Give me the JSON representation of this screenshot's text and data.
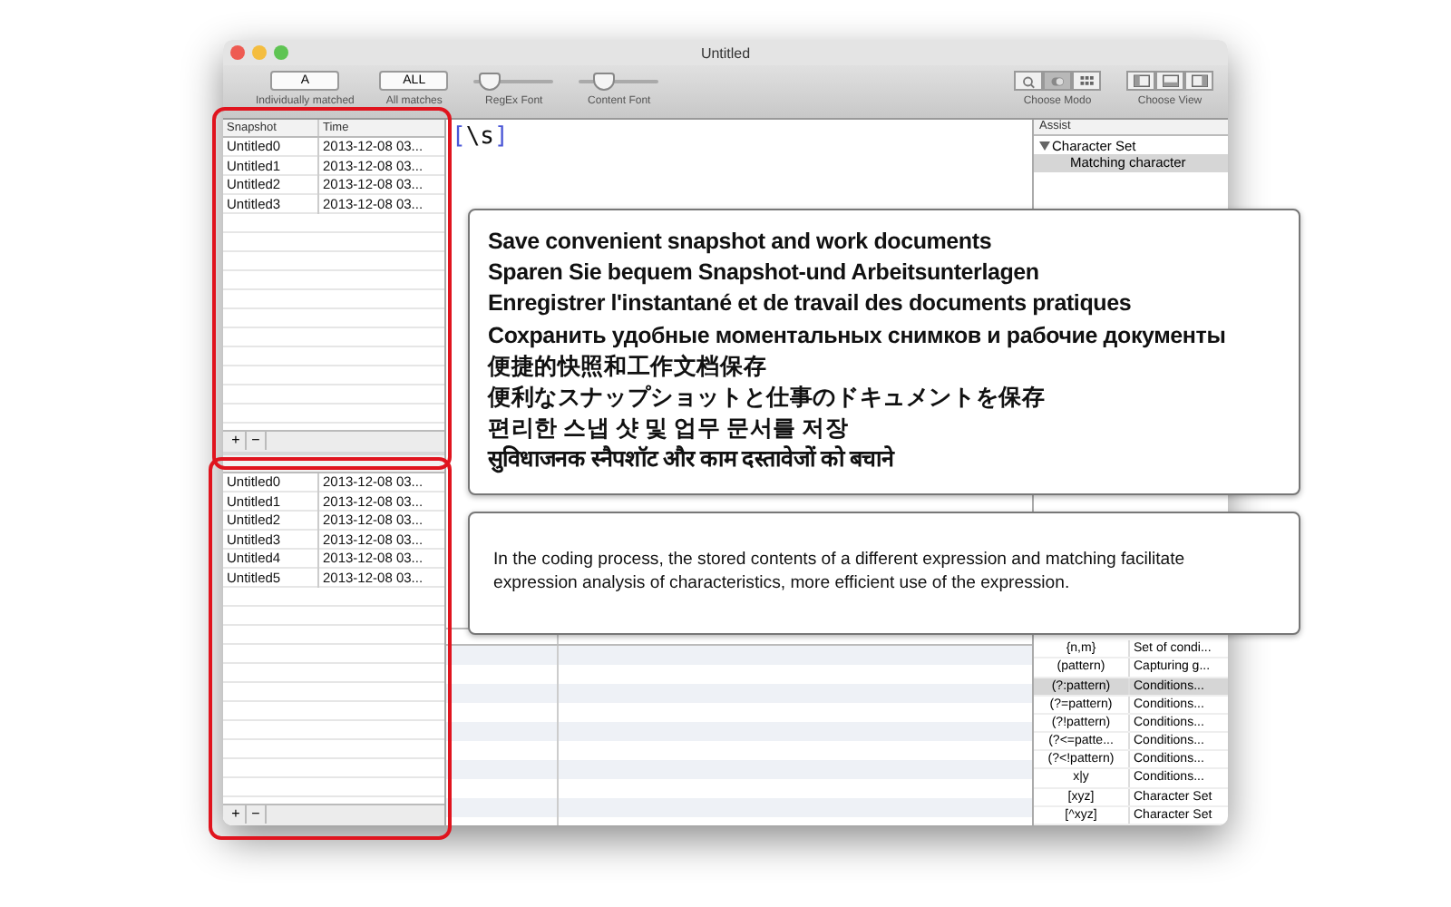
{
  "window": {
    "title": "Untitled"
  },
  "toolbar": {
    "buttons": [
      {
        "label": "A",
        "caption": "Individually matched"
      },
      {
        "label": "ALL",
        "caption": "All matches"
      }
    ],
    "sliders": [
      {
        "caption": "RegEx Font",
        "level": 0.2
      },
      {
        "caption": "Content Font",
        "level": 0.3
      }
    ],
    "segment_groups": [
      {
        "caption": "Choose Modo",
        "segments": [
          {
            "kind": "search",
            "selected": false
          },
          {
            "kind": "toggle",
            "selected": true
          },
          {
            "kind": "grid",
            "selected": false
          }
        ]
      },
      {
        "caption": "Choose View",
        "segments": [
          {
            "kind": "left",
            "selected": false
          },
          {
            "kind": "bottom",
            "selected": false
          },
          {
            "kind": "right",
            "selected": false
          }
        ]
      }
    ]
  },
  "snapshot_table": {
    "columns": [
      "Snapshot",
      "Time"
    ],
    "rows": [
      [
        "Untitled0",
        "2013-12-08 03..."
      ],
      [
        "Untitled1",
        "2013-12-08 03..."
      ],
      [
        "Untitled2",
        "2013-12-08 03..."
      ],
      [
        "Untitled3",
        "2013-12-08 03..."
      ]
    ],
    "buttons": [
      "+",
      "−"
    ]
  },
  "content_table": {
    "rows": [
      [
        "Untitled0",
        "2013-12-08 03..."
      ],
      [
        "Untitled1",
        "2013-12-08 03..."
      ],
      [
        "Untitled2",
        "2013-12-08 03..."
      ],
      [
        "Untitled3",
        "2013-12-08 03..."
      ],
      [
        "Untitled4",
        "2013-12-08 03..."
      ],
      [
        "Untitled5",
        "2013-12-08 03..."
      ]
    ],
    "buttons": [
      "+",
      "−"
    ]
  },
  "editor": {
    "tokens": [
      {
        "text": "[",
        "kind": "bracket"
      },
      {
        "text": "\\s",
        "kind": "escape"
      },
      {
        "text": "]",
        "kind": "bracket"
      }
    ]
  },
  "assist": {
    "header": "Assist",
    "tree": [
      {
        "label": "Character Set",
        "expanded": true,
        "children": [
          {
            "label": "Matching character",
            "selected": true
          }
        ]
      }
    ],
    "rows": [
      {
        "pattern": "{n,m}",
        "description": "Set of condi...",
        "selected": false
      },
      {
        "pattern": "(pattern)",
        "description": "Capturing g...",
        "selected": false
      },
      {
        "pattern": "(?:pattern)",
        "description": "Conditions...",
        "selected": true
      },
      {
        "pattern": "(?=pattern)",
        "description": "Conditions...",
        "selected": false
      },
      {
        "pattern": "(?!pattern)",
        "description": "Conditions...",
        "selected": false
      },
      {
        "pattern": "(?<=patte...",
        "description": "Conditions...",
        "selected": false
      },
      {
        "pattern": "(?<!pattern)",
        "description": "Conditions...",
        "selected": false
      },
      {
        "pattern": "x|y",
        "description": "Conditions...",
        "selected": false
      },
      {
        "pattern": "[xyz]",
        "description": "Character Set",
        "selected": false
      },
      {
        "pattern": "[^xyz]",
        "description": "Character Set",
        "selected": false
      }
    ]
  },
  "callouts": [
    {
      "kind": "lines",
      "lines": [
        "Save convenient snapshot and work documents",
        "Sparen Sie bequem Snapshot-und Arbeitsunterlagen",
        "Enregistrer l'instantané et de travail des documents pratiques",
        "Сохранить удобные моментальных снимков и рабочие документы",
        "便捷的快照和工作文档保存",
        "便利なスナップショットと仕事のドキュメントを保存",
        "편리한 스냅 샷 및 업무 문서를 저장",
        "सुविधाजनक स्नैपशॉट और काम दस्तावेजों को बचाने"
      ]
    },
    {
      "kind": "paragraph",
      "text": "In the coding process, the stored contents of a different expression and matching facilitate expression analysis of characteristics, more efficient use of the expression."
    }
  ]
}
